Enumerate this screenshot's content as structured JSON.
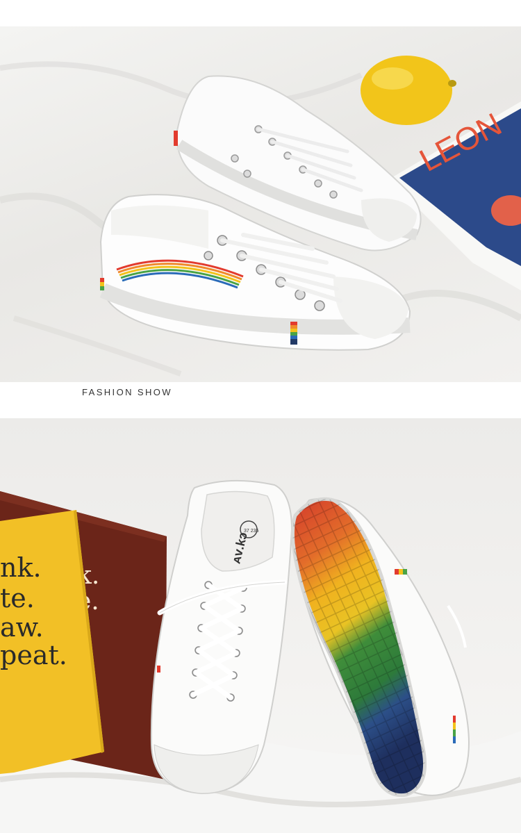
{
  "section": {
    "caption": "FASHION SHOW"
  },
  "photo1": {
    "magazine_text": "LEON",
    "objects": [
      "lemon",
      "magazine",
      "white-canvas-sneakers-rainbow"
    ]
  },
  "photo2": {
    "book_lines": [
      "nk.",
      "te.",
      "aw.",
      "peat."
    ],
    "back_book_lines": [
      "k.",
      "e."
    ],
    "insole_brand": "ᴀᴠ.kɔ",
    "insole_size": "37 235",
    "objects": [
      "yellow-book",
      "brown-book",
      "white-sneaker",
      "rainbow-sole-sneaker"
    ]
  },
  "colors": {
    "rainbow": [
      "#e23b2e",
      "#f08a2c",
      "#f2c21b",
      "#4aa346",
      "#2a6bb8",
      "#223a66"
    ]
  }
}
